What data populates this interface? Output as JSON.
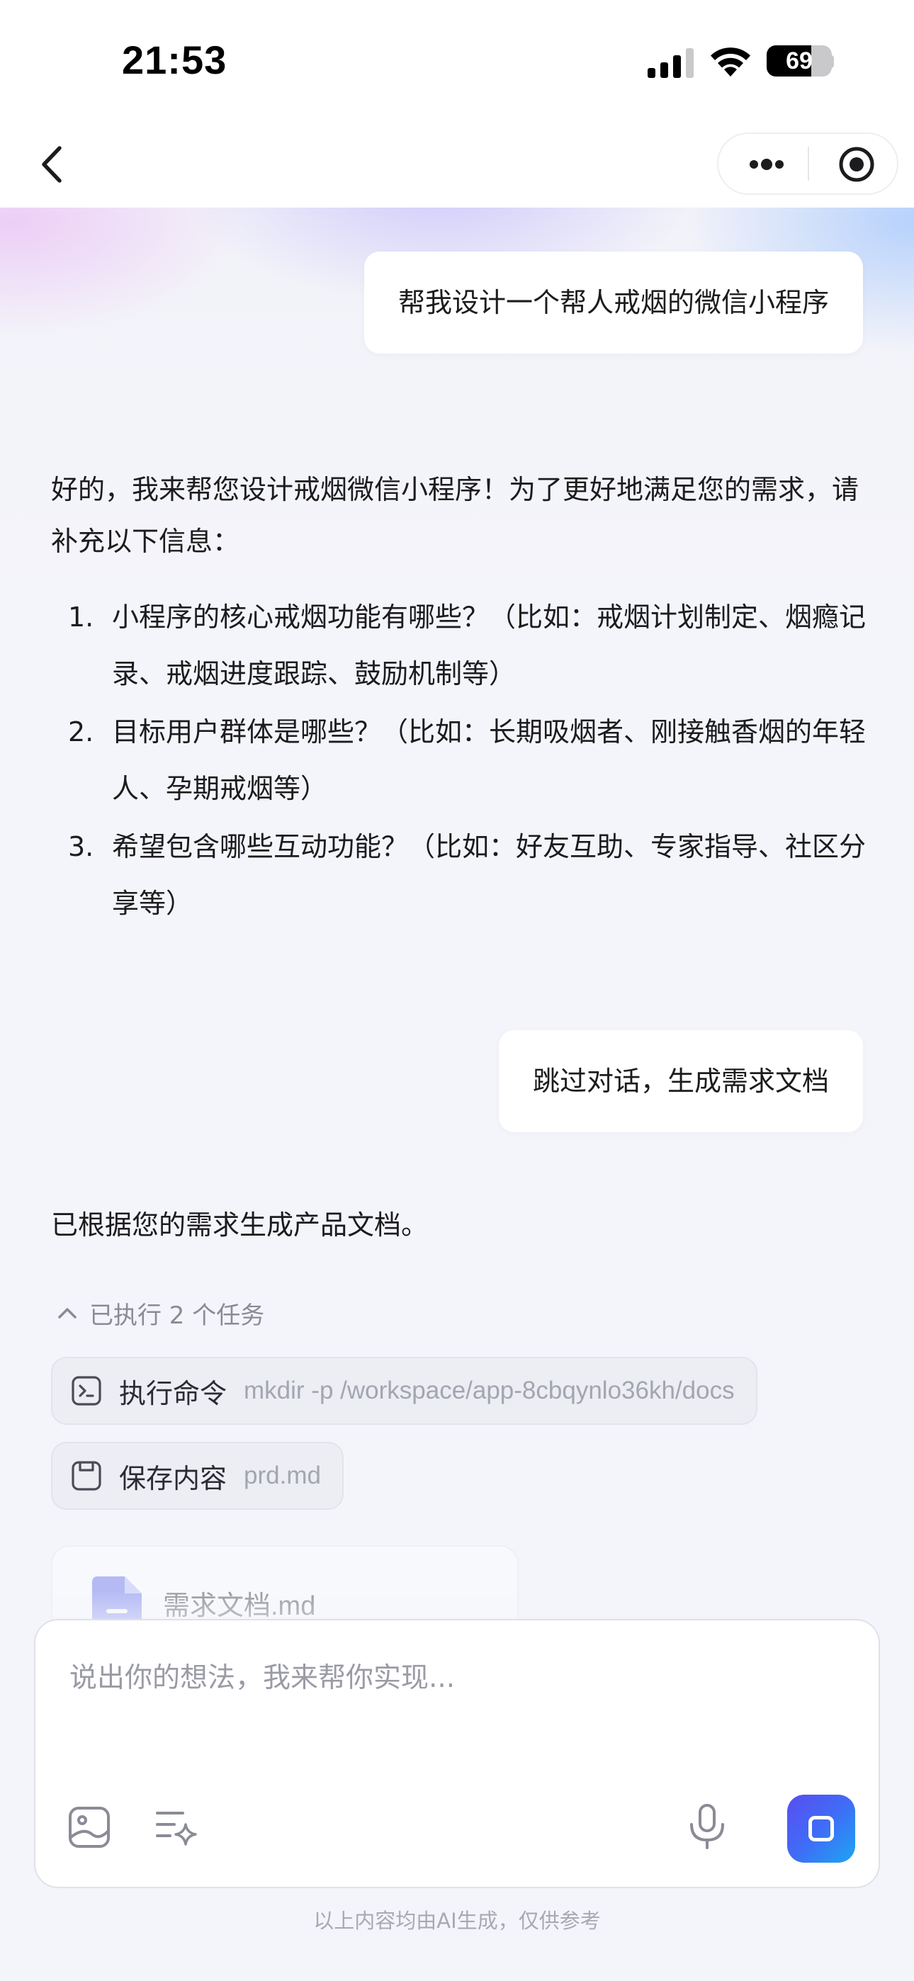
{
  "status_bar": {
    "time": "21:53",
    "battery_level": "69",
    "battery_percent": 69
  },
  "nav": {
    "back_icon": "chevron-left-icon",
    "more_icon": "ellipsis-icon",
    "close_icon": "target-circle-icon"
  },
  "conversation": {
    "user_message_1": "帮我设计一个帮人戒烟的微信小程序",
    "ai_reply_intro": "好的，我来帮您设计戒烟微信小程序！为了更好地满足您的需求，请补充以下信息：",
    "ai_questions": [
      {
        "num": "1.",
        "text": "小程序的核心戒烟功能有哪些？（比如：戒烟计划制定、烟瘾记录、戒烟进度跟踪、鼓励机制等）"
      },
      {
        "num": "2.",
        "text": "目标用户群体是哪些？（比如：长期吸烟者、刚接触香烟的年轻人、孕期戒烟等）"
      },
      {
        "num": "3.",
        "text": "希望包含哪些互动功能？（比如：好友互助、专家指导、社区分享等）"
      }
    ],
    "user_message_2": "跳过对话，生成需求文档",
    "ai_reply_2": "已根据您的需求生成产品文档。",
    "tasks_toggle": "已执行 2 个任务",
    "tasks": [
      {
        "icon": "terminal-icon",
        "label": "执行命令",
        "detail": "mkdir -p /workspace/app-8cbqynlo36kh/docs"
      },
      {
        "icon": "save-icon",
        "label": "保存内容",
        "detail": "prd.md"
      }
    ],
    "file_card": {
      "icon": "document-icon",
      "name": "需求文档.md"
    }
  },
  "input": {
    "placeholder": "说出你的想法，我来帮你实现...",
    "image_icon": "image-icon",
    "prompt_icon": "sparkle-list-icon",
    "mic_icon": "microphone-icon",
    "send_icon": "stop-icon"
  },
  "footer": {
    "disclaimer": "以上内容均由AI生成，仅供参考"
  },
  "colors": {
    "accent_gradient_start": "#5a4df0",
    "accent_gradient_end": "#1ca6f2",
    "background": "#f4f5fa",
    "muted_text": "#9a9ba5"
  }
}
